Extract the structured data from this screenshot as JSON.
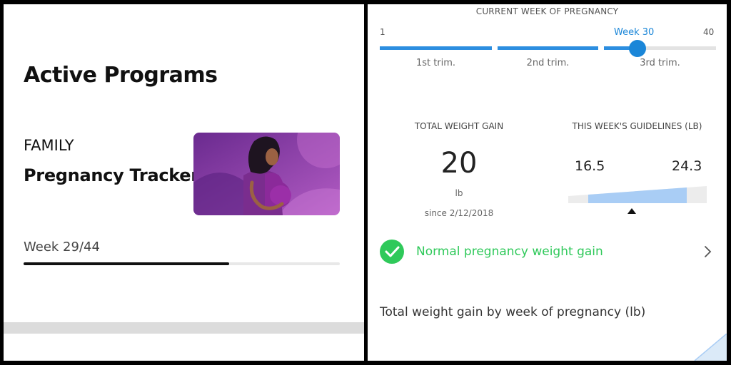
{
  "left": {
    "title": "Active Programs",
    "program": {
      "category": "FAMILY",
      "name": "Pregnancy Tracker",
      "week_label": "Week 29/44",
      "progress": 0.65
    },
    "colors": {
      "image_bg": "#8a3fa0",
      "progress": "#111111"
    }
  },
  "right": {
    "week_section": {
      "header": "CURRENT WEEK OF PREGNANCY",
      "min_label": "1",
      "max_label": "40",
      "current_label": "Week 30",
      "current_week": 30,
      "trimesters": [
        "1st trim.",
        "2nd trim.",
        "3rd trim."
      ]
    },
    "weight": {
      "header": "TOTAL WEIGHT GAIN",
      "value": "20",
      "unit": "lb",
      "since": "since 2/12/2018"
    },
    "guidelines": {
      "header": "THIS WEEK'S GUIDELINES (LB)",
      "min": "16.5",
      "max": "24.3"
    },
    "status": {
      "text": "Normal pregnancy weight gain",
      "icon": "check-circle-icon",
      "chevron": "chevron-right-icon",
      "color": "#2fc95a"
    },
    "chart": {
      "title": "Total weight gain by week of pregnancy (lb)"
    },
    "colors": {
      "accent": "#1a86d8",
      "guideline_band": "#a9cdf5"
    }
  }
}
